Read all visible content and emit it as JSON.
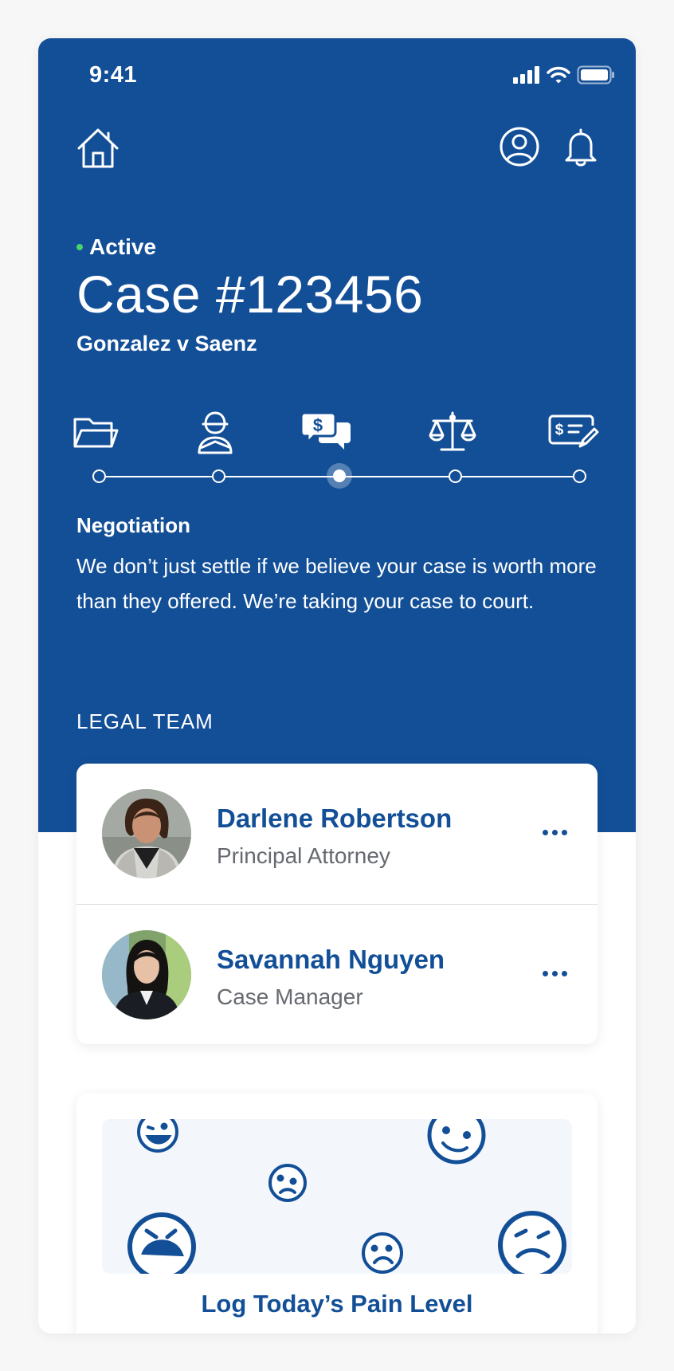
{
  "status_bar": {
    "time": "9:41"
  },
  "case": {
    "status": "Active",
    "title": "Case #123456",
    "subtitle": "Gonzalez v Saenz"
  },
  "progress": {
    "stages": [
      {
        "icon": "folder-icon"
      },
      {
        "icon": "injured-person-icon"
      },
      {
        "icon": "negotiation-chat-dollar-icon"
      },
      {
        "icon": "scales-of-justice-icon"
      },
      {
        "icon": "check-payment-icon"
      }
    ],
    "active_index": 2
  },
  "current_stage": {
    "title": "Negotiation",
    "description": "We don’t just settle if we believe your case is worth more than they offered. We’re taking your case to court."
  },
  "legal_team": {
    "label": "LEGAL TEAM",
    "members": [
      {
        "name": "Darlene Robertson",
        "role": "Principal Attorney"
      },
      {
        "name": "Savannah Nguyen",
        "role": "Case Manager"
      }
    ]
  },
  "pain": {
    "cta": "Log Today’s Pain Level"
  },
  "colors": {
    "brand": "#134f97",
    "active_dot": "#49d46a",
    "muted_text": "#666a70"
  }
}
